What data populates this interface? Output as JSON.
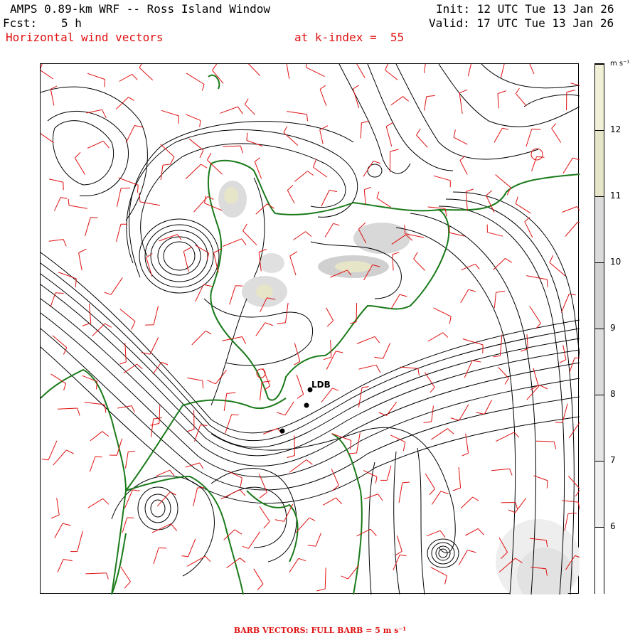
{
  "header": {
    "title": "AMPS 0.89-km WRF -- Ross Island Window",
    "fcst_label": "Fcst:",
    "fcst_value": "5 h",
    "init": "Init: 12 UTC Tue 13 Jan 26",
    "valid": "Valid: 17 UTC Tue 13 Jan 26",
    "field": "Horizontal wind vectors",
    "level": "at k-index =  55"
  },
  "colorbar": {
    "unit": "m s⁻¹",
    "labels": [
      "12",
      "11",
      "10",
      "9",
      "8",
      "7",
      "6"
    ],
    "colors": [
      "#f2f1d8",
      "#e6e5c8",
      "#dcdcdc",
      "#d2d2d2",
      "#dddddd",
      "#e6e6e6",
      "#f0f0f0",
      "#ffffff"
    ]
  },
  "map": {
    "station_label": "LDB",
    "coast_color": "#1a7a1a",
    "barb_color": "#e01010",
    "streamline_color": "#000000"
  },
  "footer": {
    "text": "BARB VECTORS:  FULL BARB = 5 m s⁻¹"
  }
}
